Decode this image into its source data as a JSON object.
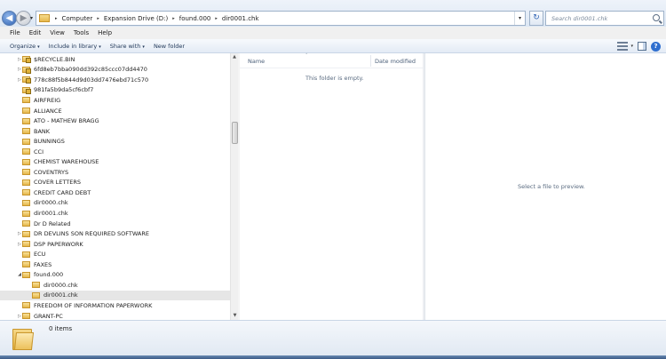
{
  "address": {
    "crumbs": [
      "Computer",
      "Expansion Drive (D:)",
      "found.000",
      "dir0001.chk"
    ],
    "search_placeholder": "Search dir0001.chk"
  },
  "menu": {
    "items": [
      "File",
      "Edit",
      "View",
      "Tools",
      "Help"
    ]
  },
  "toolbar": {
    "organize": "Organize",
    "include_in_library": "Include in library",
    "share_with": "Share with",
    "new_folder": "New folder"
  },
  "nav": {
    "items": [
      {
        "label": "$RECYCLE.BIN",
        "expand": "▷",
        "indent": 1,
        "lock": true
      },
      {
        "label": "6fd8eb7bba090dd392c85ccc07dd4470",
        "expand": "▷",
        "indent": 1,
        "lock": true
      },
      {
        "label": "778c88f5b844d9d03dd7476ebd71c570",
        "expand": "▷",
        "indent": 1,
        "lock": true
      },
      {
        "label": "981fa5b9da5cf6cbf7",
        "expand": "",
        "indent": 1,
        "lock": true
      },
      {
        "label": "AIRFREIG",
        "expand": "",
        "indent": 1,
        "lock": false
      },
      {
        "label": "ALLIANCE",
        "expand": "",
        "indent": 1,
        "lock": false
      },
      {
        "label": "ATO - MATHEW BRAGG",
        "expand": "",
        "indent": 1,
        "lock": false
      },
      {
        "label": "BANK",
        "expand": "",
        "indent": 1,
        "lock": false
      },
      {
        "label": "BUNNINGS",
        "expand": "",
        "indent": 1,
        "lock": false
      },
      {
        "label": "CCI",
        "expand": "",
        "indent": 1,
        "lock": false
      },
      {
        "label": "CHEMIST WAREHOUSE",
        "expand": "",
        "indent": 1,
        "lock": false
      },
      {
        "label": "COVENTRYS",
        "expand": "",
        "indent": 1,
        "lock": false
      },
      {
        "label": "COVER LETTERS",
        "expand": "",
        "indent": 1,
        "lock": false
      },
      {
        "label": "CREDIT CARD DEBT",
        "expand": "",
        "indent": 1,
        "lock": false
      },
      {
        "label": "dir0000.chk",
        "expand": "",
        "indent": 1,
        "lock": false
      },
      {
        "label": "dir0001.chk",
        "expand": "",
        "indent": 1,
        "lock": false
      },
      {
        "label": "Dr D Related",
        "expand": "",
        "indent": 1,
        "lock": false
      },
      {
        "label": "DR DEVLINS SON REQUIRED SOFTWARE",
        "expand": "▷",
        "indent": 1,
        "lock": false
      },
      {
        "label": "DSP PAPERWORK",
        "expand": "▷",
        "indent": 1,
        "lock": false
      },
      {
        "label": "ECU",
        "expand": "",
        "indent": 1,
        "lock": false
      },
      {
        "label": "FAXES",
        "expand": "",
        "indent": 1,
        "lock": false
      },
      {
        "label": "found.000",
        "expand": "◢",
        "indent": 1,
        "lock": false
      },
      {
        "label": "dir0000.chk",
        "expand": "",
        "indent": 2,
        "lock": false
      },
      {
        "label": "dir0001.chk",
        "expand": "",
        "indent": 2,
        "lock": false,
        "selected": true
      },
      {
        "label": "FREEDOM OF INFORMATION PAPERWORK",
        "expand": "",
        "indent": 1,
        "lock": false
      },
      {
        "label": "GRANT-PC",
        "expand": "▷",
        "indent": 1,
        "lock": false
      }
    ]
  },
  "filelist": {
    "col_name": "Name",
    "col_date": "Date modified",
    "empty_message": "This folder is empty."
  },
  "preview": {
    "message": "Select a file to preview."
  },
  "details": {
    "item_count": "0 items"
  }
}
